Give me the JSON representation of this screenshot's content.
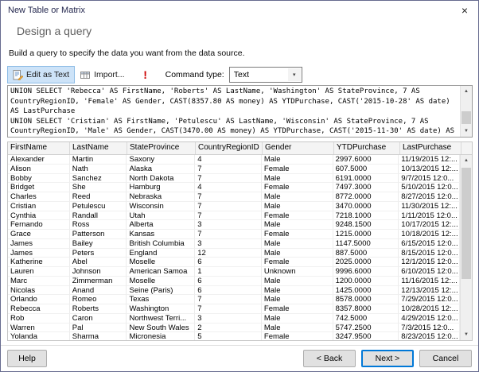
{
  "window": {
    "title": "New Table or Matrix"
  },
  "header": {
    "title": "Design a query",
    "subtitle": "Build a query to specify the data you want from the data source."
  },
  "toolbar": {
    "edit_as_text": "Edit as Text",
    "import": "Import...",
    "command_type_label": "Command type:",
    "command_type_value": "Text"
  },
  "icons": {
    "close": "×",
    "run": "!",
    "dropdown": "▾",
    "scroll_up": "▲",
    "scroll_down": "▼"
  },
  "query": {
    "lines": [
      "UNION SELECT 'Rebecca' AS FirstName, 'Roberts' AS LastName, 'Washington' AS StateProvince, 7 AS",
      "CountryRegionID, 'Female' AS Gender, CAST(8357.80 AS money) AS YTDPurchase, CAST('2015-10-28' AS date)",
      "AS LastPurchase",
      "UNION SELECT 'Cristian' AS FirstName, 'Petulescu' AS LastName, 'Wisconsin' AS StateProvince, 7 AS",
      "CountryRegionID, 'Male' AS Gender, CAST(3470.00 AS money) AS YTDPurchase, CAST('2015-11-30' AS date) AS"
    ]
  },
  "grid": {
    "columns": [
      "FirstName",
      "LastName",
      "StateProvince",
      "CountryRegionID",
      "Gender",
      "YTDPurchase",
      "LastPurchase"
    ],
    "rows": [
      [
        "Alexander",
        "Martin",
        "Saxony",
        "4",
        "Male",
        "2997.6000",
        "11/19/2015 12:..."
      ],
      [
        "Alison",
        "Nath",
        "Alaska",
        "7",
        "Female",
        "607.5000",
        "10/13/2015 12:..."
      ],
      [
        "Bobby",
        "Sanchez",
        "North Dakota",
        "7",
        "Male",
        "6191.0000",
        "9/7/2015 12:0..."
      ],
      [
        "Bridget",
        "She",
        "Hamburg",
        "4",
        "Female",
        "7497.3000",
        "5/10/2015 12:0..."
      ],
      [
        "Charles",
        "Reed",
        "Nebraska",
        "7",
        "Male",
        "8772.0000",
        "8/27/2015 12:0..."
      ],
      [
        "Cristian",
        "Petulescu",
        "Wisconsin",
        "7",
        "Male",
        "3470.0000",
        "11/30/2015 12:..."
      ],
      [
        "Cynthia",
        "Randall",
        "Utah",
        "7",
        "Female",
        "7218.1000",
        "1/11/2015 12:0..."
      ],
      [
        "Fernando",
        "Ross",
        "Alberta",
        "3",
        "Male",
        "9248.1500",
        "10/17/2015 12:..."
      ],
      [
        "Grace",
        "Patterson",
        "Kansas",
        "7",
        "Female",
        "1215.0000",
        "10/18/2015 12:..."
      ],
      [
        "James",
        "Bailey",
        "British Columbia",
        "3",
        "Male",
        "1147.5000",
        "6/15/2015 12:0..."
      ],
      [
        "James",
        "Peters",
        "England",
        "12",
        "Male",
        "887.5000",
        "8/15/2015 12:0..."
      ],
      [
        "Katherine",
        "Abel",
        "Moselle",
        "6",
        "Female",
        "2025.0000",
        "12/1/2015 12:0..."
      ],
      [
        "Lauren",
        "Johnson",
        "American Samoa",
        "1",
        "Unknown",
        "9996.6000",
        "6/10/2015 12:0..."
      ],
      [
        "Marc",
        "Zimmerman",
        "Moselle",
        "6",
        "Male",
        "1200.0000",
        "11/16/2015 12:..."
      ],
      [
        "Nicolas",
        "Anand",
        "Seine (Paris)",
        "6",
        "Male",
        "1425.0000",
        "12/13/2015 12:..."
      ],
      [
        "Orlando",
        "Romeo",
        "Texas",
        "7",
        "Male",
        "8578.0000",
        "7/29/2015 12:0..."
      ],
      [
        "Rebecca",
        "Roberts",
        "Washington",
        "7",
        "Female",
        "8357.8000",
        "10/28/2015 12:..."
      ],
      [
        "Rob",
        "Caron",
        "Northwest Terri...",
        "3",
        "Male",
        "742.5000",
        "4/29/2015 12:0..."
      ],
      [
        "Warren",
        "Pal",
        "New South Wales",
        "2",
        "Male",
        "5747.2500",
        "7/3/2015 12:0..."
      ],
      [
        "Yolanda",
        "Sharma",
        "Micronesia",
        "5",
        "Female",
        "3247.9500",
        "8/23/2015 12:0..."
      ]
    ]
  },
  "footer": {
    "help": "Help",
    "back": "< Back",
    "next": "Next >",
    "cancel": "Cancel"
  }
}
